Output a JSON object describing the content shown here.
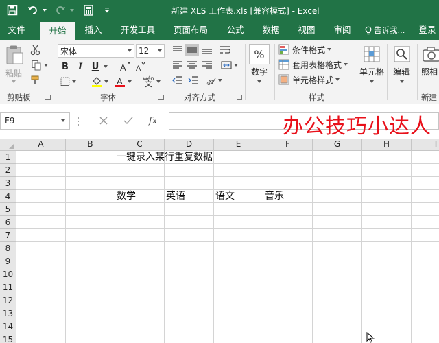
{
  "window": {
    "title": "新建 XLS 工作表.xls  [兼容模式] - Excel",
    "accent": "#217346"
  },
  "tabs": [
    {
      "label": "文件"
    },
    {
      "label": "开始"
    },
    {
      "label": "插入"
    },
    {
      "label": "开发工具"
    },
    {
      "label": "页面布局"
    },
    {
      "label": "公式"
    },
    {
      "label": "数据"
    },
    {
      "label": "视图"
    },
    {
      "label": "审阅"
    },
    {
      "label": "告诉我..."
    },
    {
      "label": "登录"
    }
  ],
  "active_tab": "开始",
  "ribbon": {
    "clipboard": {
      "paste_label": "粘贴",
      "group_label": "剪贴板"
    },
    "font": {
      "family": "宋体",
      "size": "12",
      "group_label": "字体",
      "bold": "B",
      "italic": "I",
      "underline": "U",
      "phonetic": "wén"
    },
    "alignment": {
      "group_label": "对齐方式"
    },
    "number": {
      "label": "数字",
      "symbol": "%"
    },
    "styles": {
      "conditional": "条件格式",
      "table": "套用表格格式",
      "cell_styles": "单元格样式",
      "group_label": "样式"
    },
    "cells": {
      "label": "单元格"
    },
    "editing": {
      "label": "编辑"
    },
    "photo": {
      "label": "照相"
    },
    "new_group": {
      "label": "新建"
    }
  },
  "formula_bar": {
    "name_box": "F9",
    "fx": "fx",
    "overlay_text": "办公技巧小达人",
    "overlay_color": "#e8101a"
  },
  "sheet": {
    "columns": [
      "A",
      "B",
      "C",
      "D",
      "E",
      "F",
      "G",
      "H",
      "I"
    ],
    "rows": [
      "1",
      "2",
      "3",
      "4",
      "5",
      "6",
      "7",
      "8",
      "9",
      "10",
      "11",
      "12",
      "13",
      "14",
      "15"
    ],
    "cells": {
      "C1": "一键录入某行重复数据",
      "C4": "数学",
      "D4": "英语",
      "E4": "语文",
      "F4": "音乐"
    }
  }
}
